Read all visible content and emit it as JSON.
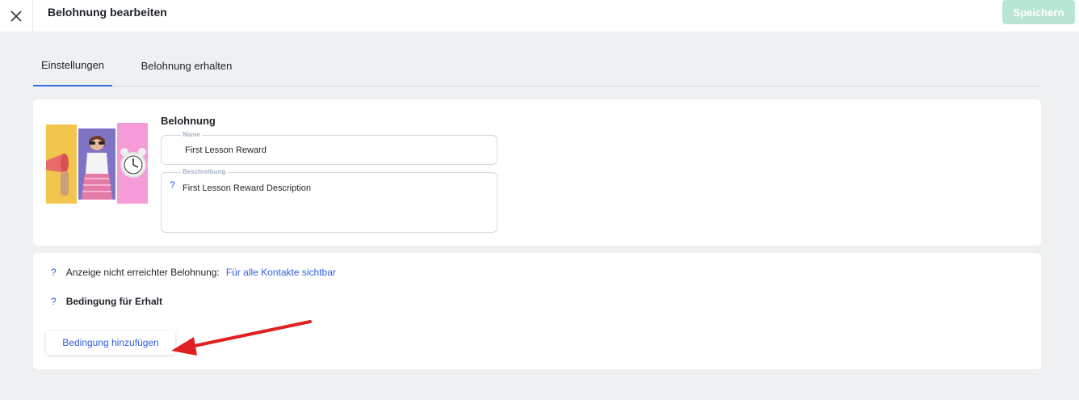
{
  "header": {
    "title": "Belohnung bearbeiten",
    "save_label": "Speichern"
  },
  "tabs": [
    {
      "label": "Einstellungen",
      "active": true
    },
    {
      "label": "Belohnung erhalten",
      "active": false
    }
  ],
  "reward": {
    "section_title": "Belohnung",
    "name_label": "Name",
    "name_value": "First Lesson Reward",
    "description_label": "Beschreibung",
    "description_value": "First Lesson Reward Description",
    "help_icon": "?"
  },
  "visibility": {
    "help_icon": "?",
    "label": "Anzeige nicht erreichter Belohnung:",
    "value": "Für alle Kontakte sichtbar"
  },
  "condition": {
    "help_icon": "?",
    "label": "Bedingung für Erhalt",
    "add_button": "Bedingung hinzufügen"
  },
  "colors": {
    "accent": "#2f5fe0",
    "save_disabled": "#b9e6d3",
    "annotation_arrow": "#e02020",
    "background": "#eef0f1"
  }
}
